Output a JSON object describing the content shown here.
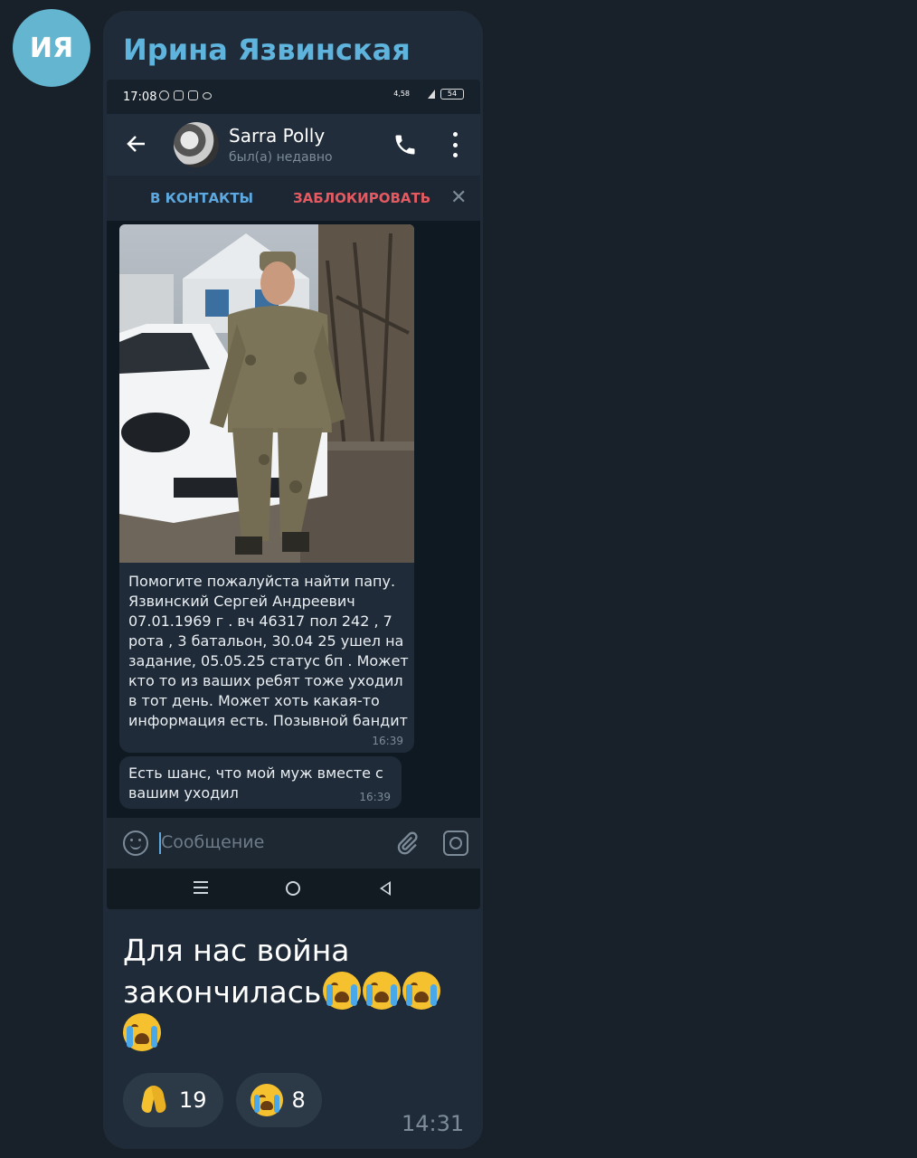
{
  "sender": {
    "initials": "ИЯ",
    "name": "Ирина Язвинская"
  },
  "screenshot": {
    "status_bar": {
      "time": "17:08",
      "net_speed": "4,58",
      "battery": "54"
    },
    "chat_header": {
      "contact_name": "Sarra Polly",
      "contact_status": "был(а) недавно"
    },
    "action_bar": {
      "add_contact": "В КОНТАКТЫ",
      "block": "ЗАБЛОКИРОВАТЬ"
    },
    "messages": [
      {
        "text": "Помогите пожалуйста найти папу. Язвинский Сергей Андреевич 07.01.1969 г . вч 46317 пол 242 , 7 рота , 3 батальон, 30.04 25 ушел на задание, 05.05.25 статус бп . Может кто то из ваших ребят тоже уходил в тот день. Может хоть какая-то информация есть. Позывной бандит",
        "time": "16:39"
      },
      {
        "text": "Есть шанс, что мой муж вместе с вашим уходил",
        "time": "16:39"
      }
    ],
    "input": {
      "placeholder": "Сообщение"
    }
  },
  "caption": {
    "text": "Для нас война закончилась"
  },
  "reactions": [
    {
      "icon": "folded-hands",
      "count": "19"
    },
    {
      "icon": "loudly-crying-face",
      "count": "8"
    }
  ],
  "post_time": "14:31",
  "colors": {
    "background": "#182029",
    "bubble": "#1f2b38",
    "sender_name": "#5fb4dd",
    "add_contact": "#5ea8e0",
    "block": "#e55a61"
  }
}
